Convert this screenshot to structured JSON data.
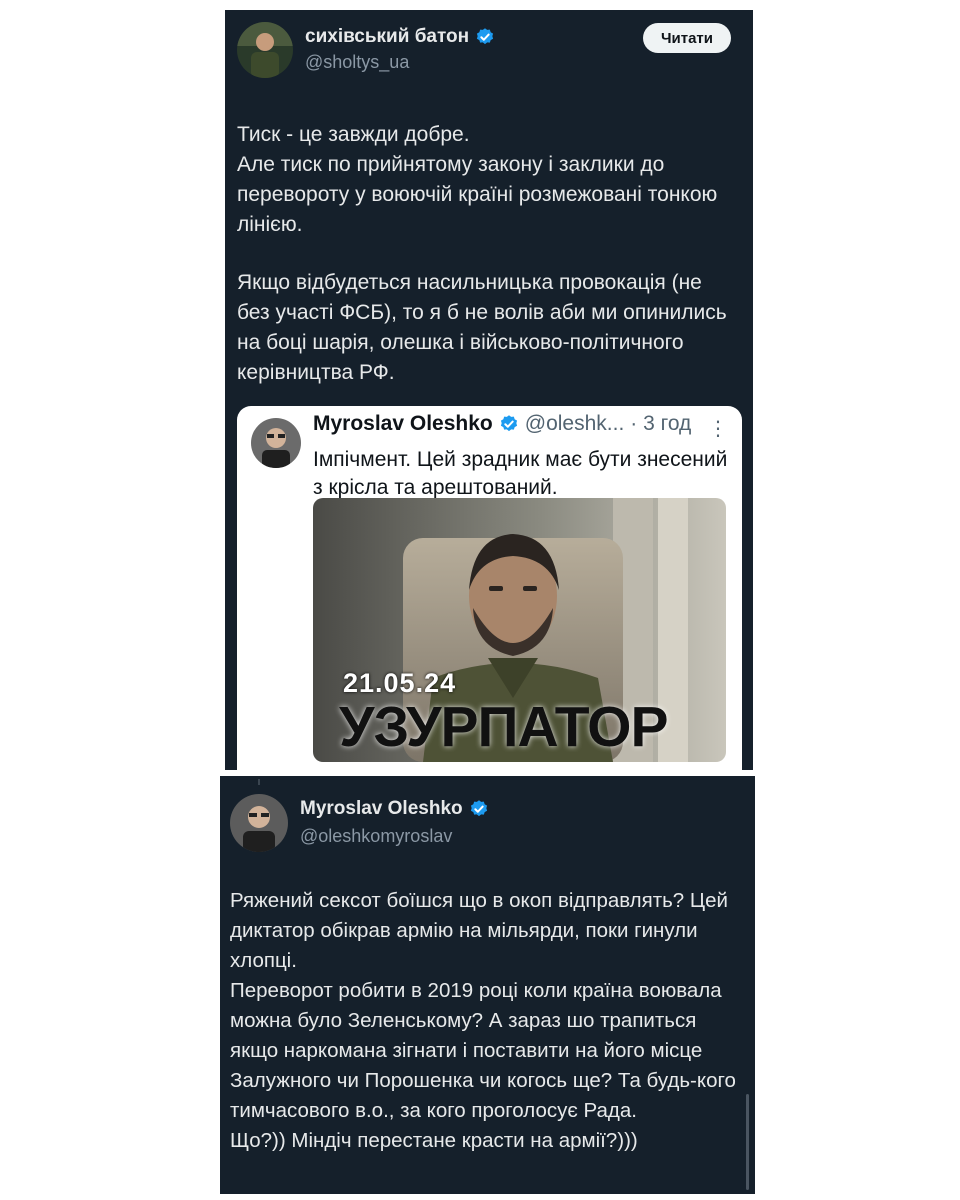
{
  "top_tweet": {
    "display_name": "сихівський батон",
    "handle": "@sholtys_ua",
    "follow_label": "Читати",
    "paragraphs": [
      "Тиск - це завжди добре.\nАле тиск по прийнятому закону і заклики до перевороту у воюючій країні розмежовані тонкою лінією.",
      "Якщо відбудеться насильницька провокація (не без участі ФСБ), то я б не волів аби ми опинились на боці шарія, олешка і військово-політичного керівництва РФ."
    ]
  },
  "quoted_tweet": {
    "display_name": "Myroslav Oleshko",
    "handle": "@oleshk...",
    "time": "· 3 год",
    "text": "Імпічмент. Цей зрадник має бути знесений з крісла та арештований.",
    "media": {
      "date": "21.05.24",
      "caption": "УЗУРПАТОР"
    }
  },
  "reply_tweet": {
    "display_name": "Myroslav Oleshko",
    "handle": "@oleshkomyroslav",
    "text": "Ряжений сексот боїшся що в окоп відправлять? Цей диктатор обікрав армію на мільярди, поки гинули хлопці.\nПереворот робити в 2019 році коли країна воювала можна було Зеленському? А зараз шо трапиться якщо наркомана зігнати і поставити на його місце Залужного чи Порошенка чи когось ще? Та будь-кого тимчасового в.о., за кого проголосує Рада.\nЩо?)) Міндіч перестане красти на армії?)))"
  },
  "colors": {
    "dark_bg": "#15202b",
    "verified_blue": "#1d9bf0",
    "text_light": "#e7e9ea",
    "text_muted": "#8b98a5"
  }
}
